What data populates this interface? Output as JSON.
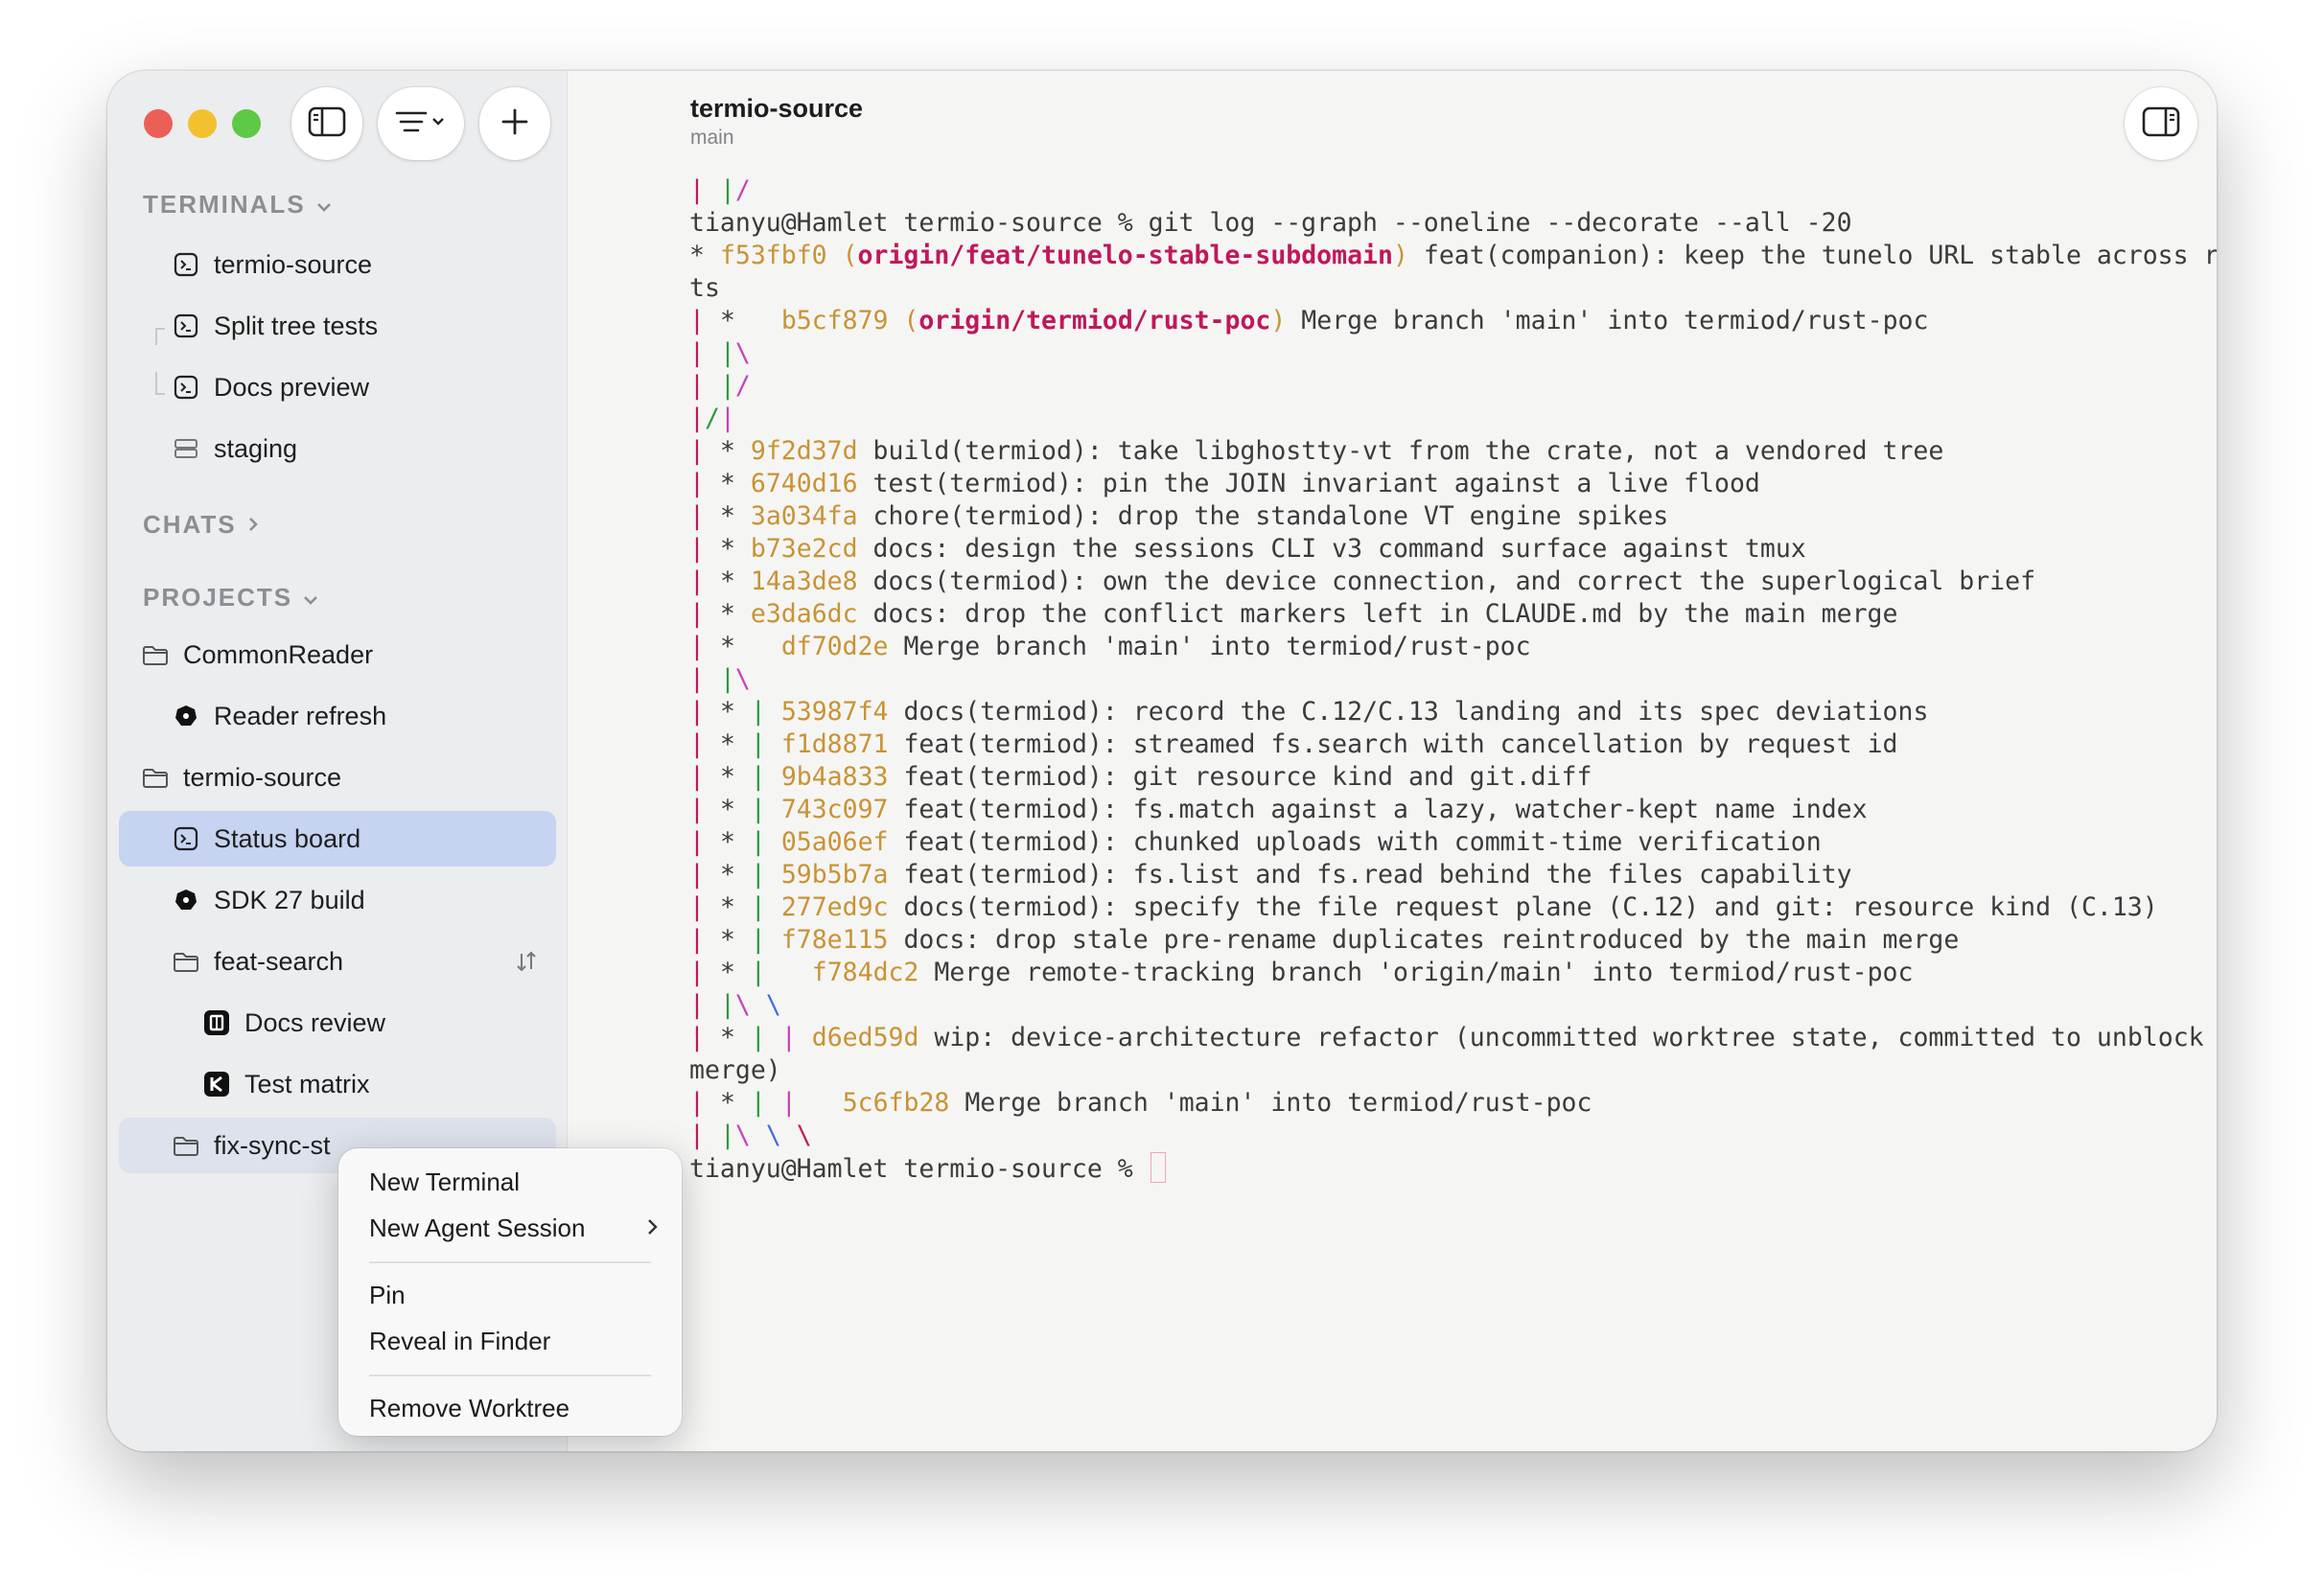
{
  "window": {
    "title": "termio-source",
    "subtitle": "main"
  },
  "colors": {
    "close": "#ec5f57",
    "minimize": "#f5c02f",
    "zoom": "#5dc945",
    "selection": "#c6d4f2",
    "graph_red": "#c2185b",
    "hash": "#c99334"
  },
  "toolbar": {
    "sidebar_icon": "sidebar-toggle-icon",
    "filter_icon": "filter-lines-icon",
    "add_icon": "plus-icon",
    "panel_icon": "right-panel-icon"
  },
  "sidebar": {
    "terminals_header": "TERMINALS",
    "terminals": [
      {
        "label": "termio-source",
        "icon": "terminal-icon"
      },
      {
        "label": "Split tree tests",
        "icon": "terminal-icon"
      },
      {
        "label": "Docs preview",
        "icon": "terminal-icon"
      },
      {
        "label": "staging",
        "icon": "server-icon"
      }
    ],
    "chats_header": "CHATS",
    "projects_header": "PROJECTS",
    "projects": [
      {
        "label": "CommonReader",
        "icon": "folder-icon"
      },
      {
        "label": "Reader refresh",
        "icon": "agent-icon"
      },
      {
        "label": "termio-source",
        "icon": "folder-icon"
      },
      {
        "label": "Status board",
        "icon": "terminal-icon"
      },
      {
        "label": "SDK 27 build",
        "icon": "agent-icon"
      },
      {
        "label": "feat-search",
        "icon": "folder-icon"
      },
      {
        "label": "Docs review",
        "icon": "app-square-icon"
      },
      {
        "label": "Test matrix",
        "icon": "k-icon"
      },
      {
        "label": "fix-sync-st",
        "icon": "folder-icon"
      }
    ]
  },
  "terminal": {
    "lines": [
      {
        "graph": "| |/",
        "text": ""
      },
      {
        "graph": "",
        "text": "tianyu@Hamlet termio-source % git log --graph --oneline --decorate --all -20"
      },
      {
        "graph": "* ",
        "hash": "f53fbf0",
        "ref": "origin/feat/tunelo-stable-subdomain",
        "text": " feat(companion): keep the tunelo URL stable across restar"
      },
      {
        "graph": "",
        "text": "ts"
      },
      {
        "graph": "| *   ",
        "hash": "b5cf879",
        "ref": "origin/termiod/rust-poc",
        "text": " Merge branch 'main' into termiod/rust-poc"
      },
      {
        "graph": "| |\\",
        "text": ""
      },
      {
        "graph": "| |/",
        "text": ""
      },
      {
        "graph": "|/|",
        "text": ""
      },
      {
        "graph": "| * ",
        "hash": "9f2d37d",
        "text": " build(termiod): take libghostty-vt from the crate, not a vendored tree"
      },
      {
        "graph": "| * ",
        "hash": "6740d16",
        "text": " test(termiod): pin the JOIN invariant against a live flood"
      },
      {
        "graph": "| * ",
        "hash": "3a034fa",
        "text": " chore(termiod): drop the standalone VT engine spikes"
      },
      {
        "graph": "| * ",
        "hash": "b73e2cd",
        "text": " docs: design the sessions CLI v3 command surface against tmux"
      },
      {
        "graph": "| * ",
        "hash": "14a3de8",
        "text": " docs(termiod): own the device connection, and correct the superlogical brief"
      },
      {
        "graph": "| * ",
        "hash": "e3da6dc",
        "text": " docs: drop the conflict markers left in CLAUDE.md by the main merge"
      },
      {
        "graph": "| *   ",
        "hash": "df70d2e",
        "text": " Merge branch 'main' into termiod/rust-poc"
      },
      {
        "graph": "| |\\",
        "text": ""
      },
      {
        "graph": "| * | ",
        "hash": "53987f4",
        "text": " docs(termiod): record the C.12/C.13 landing and its spec deviations"
      },
      {
        "graph": "| * | ",
        "hash": "f1d8871",
        "text": " feat(termiod): streamed fs.search with cancellation by request id"
      },
      {
        "graph": "| * | ",
        "hash": "9b4a833",
        "text": " feat(termiod): git resource kind and git.diff"
      },
      {
        "graph": "| * | ",
        "hash": "743c097",
        "text": " feat(termiod): fs.match against a lazy, watcher-kept name index"
      },
      {
        "graph": "| * | ",
        "hash": "05a06ef",
        "text": " feat(termiod): chunked uploads with commit-time verification"
      },
      {
        "graph": "| * | ",
        "hash": "59b5b7a",
        "text": " feat(termiod): fs.list and fs.read behind the files capability"
      },
      {
        "graph": "| * | ",
        "hash": "277ed9c",
        "text": " docs(termiod): specify the file request plane (C.12) and git: resource kind (C.13)"
      },
      {
        "graph": "| * | ",
        "hash": "f78e115",
        "text": " docs: drop stale pre-rename duplicates reintroduced by the main merge"
      },
      {
        "graph": "| * |   ",
        "hash": "f784dc2",
        "text": " Merge remote-tracking branch 'origin/main' into termiod/rust-poc"
      },
      {
        "graph": "| |\\ \\",
        "text": ""
      },
      {
        "graph": "| * | | ",
        "hash": "d6ed59d",
        "text": " wip: device-architecture refactor (uncommitted worktree state, committed to unblock main"
      },
      {
        "graph": "",
        "text": "merge)"
      },
      {
        "graph": "| * | |   ",
        "hash": "5c6fb28",
        "text": " Merge branch 'main' into termiod/rust-poc"
      },
      {
        "graph": "| |\\ \\ \\",
        "text": ""
      },
      {
        "graph": "",
        "text": "tianyu@Hamlet termio-source % ",
        "prompt": true
      }
    ]
  },
  "context_menu": {
    "items": [
      "New Terminal",
      "New Agent Session",
      "Pin",
      "Reveal in Finder",
      "Remove Worktree"
    ]
  }
}
